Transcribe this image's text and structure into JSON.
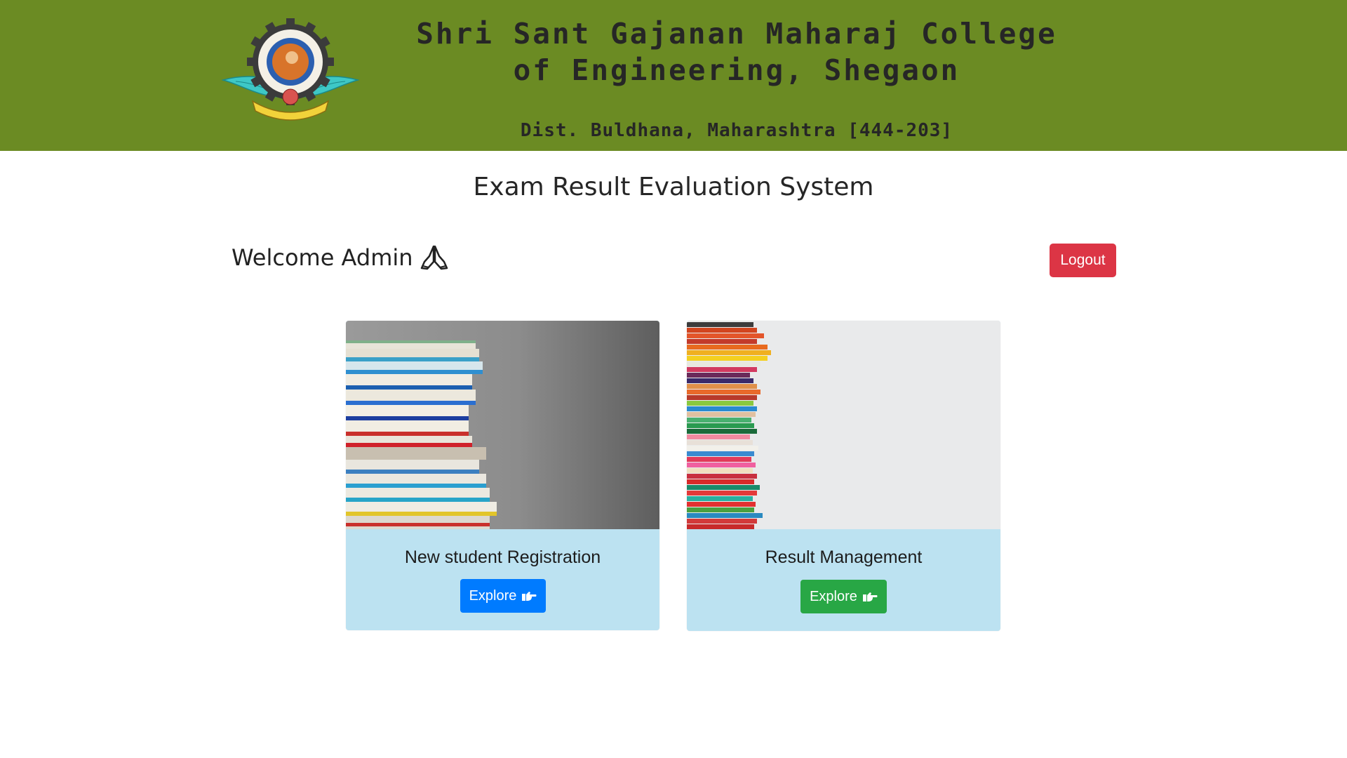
{
  "header": {
    "college_name": "Shri Sant Gajanan Maharaj College of Engineering, Shegaon",
    "address": "Dist. Buldhana, Maharashtra [444-203]",
    "bg_color": "#6b8b23",
    "logo_icon": "college-emblem-icon"
  },
  "main": {
    "title": "Exam Result Evaluation System",
    "welcome_text": "Welcome Admin",
    "welcome_icon": "folded-hands-icon",
    "logout_label": "Logout"
  },
  "cards": [
    {
      "title": "New student Registration",
      "button_label": "Explore",
      "button_icon": "pointing-hand-icon",
      "button_color": "#007bff",
      "image": "stacked-books-photo"
    },
    {
      "title": "Result Management",
      "button_label": "Explore",
      "button_icon": "pointing-hand-icon",
      "button_color": "#28a745",
      "image": "colored-pencils-photo"
    }
  ]
}
